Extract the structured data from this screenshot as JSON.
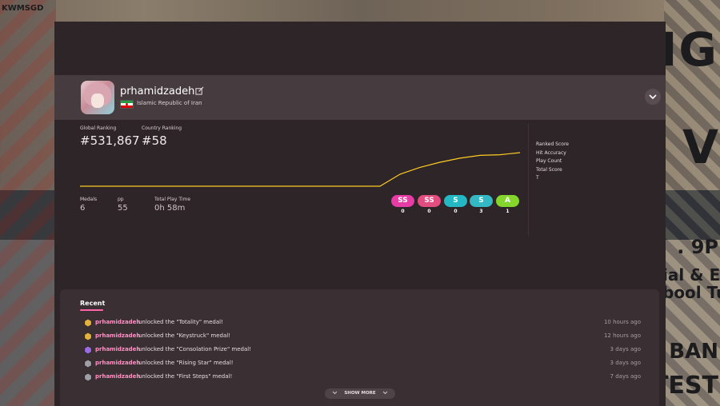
{
  "background": {
    "corner_text": "KWMSGD",
    "right_texts": [
      "IG",
      "V",
      ". 9P",
      "ial & Err\nbool Tun",
      "K BAN",
      "TEST"
    ]
  },
  "profile": {
    "username": "prhamidzadeh",
    "country": "Islamic Republic of Iran",
    "flag_colors": [
      "#239f40",
      "#ffffff",
      "#da0000"
    ]
  },
  "stats": {
    "global_ranking_label": "Global Ranking",
    "global_ranking": "#531,867",
    "country_ranking_label": "Country Ranking",
    "country_ranking": "#58",
    "medals_label": "Medals",
    "medals": "6",
    "pp_label": "pp",
    "pp": "55",
    "play_time_label": "Total Play Time",
    "play_time": "0h 58m"
  },
  "chart_data": {
    "type": "line",
    "description_color": "#ffcc22",
    "values": [
      0,
      0,
      0,
      0,
      0,
      0,
      0,
      0,
      0,
      0,
      0,
      0,
      0,
      0,
      0,
      0,
      35,
      55,
      70,
      82,
      90,
      92,
      98
    ]
  },
  "grades": [
    {
      "label": "SS",
      "count": "0",
      "color": "#e73ca5"
    },
    {
      "label": "SS",
      "count": "0",
      "color": "#e24c7e"
    },
    {
      "label": "S",
      "count": "0",
      "color": "#23b8c4"
    },
    {
      "label": "S",
      "count": "3",
      "color": "#33b8c4"
    },
    {
      "label": "A",
      "count": "1",
      "color": "#84d62c"
    }
  ],
  "side_list": [
    "Ranked Score",
    "Hit Accuracy",
    "Play Count",
    "Total Score",
    "T"
  ],
  "recent": {
    "title": "Recent",
    "items": [
      {
        "user": "prhamidzadeh",
        "text": "unlocked the \"Totality\" medal!",
        "time": "10 hours ago",
        "medal_color": "#e3b23c"
      },
      {
        "user": "prhamidzadeh",
        "text": "unlocked the \"Keystruck\" medal!",
        "time": "12 hours ago",
        "medal_color": "#e3b23c"
      },
      {
        "user": "prhamidzadeh",
        "text": "unlocked the \"Consolation Prize\" medal!",
        "time": "3 days ago",
        "medal_color": "#9a6ce0"
      },
      {
        "user": "prhamidzadeh",
        "text": "unlocked the \"Rising Star\" medal!",
        "time": "3 days ago",
        "medal_color": "#9e9ea6"
      },
      {
        "user": "prhamidzadeh",
        "text": "unlocked the \"First Steps\" medal!",
        "time": "7 days ago",
        "medal_color": "#9e9ea6"
      }
    ],
    "show_more": "SHOW MORE"
  }
}
